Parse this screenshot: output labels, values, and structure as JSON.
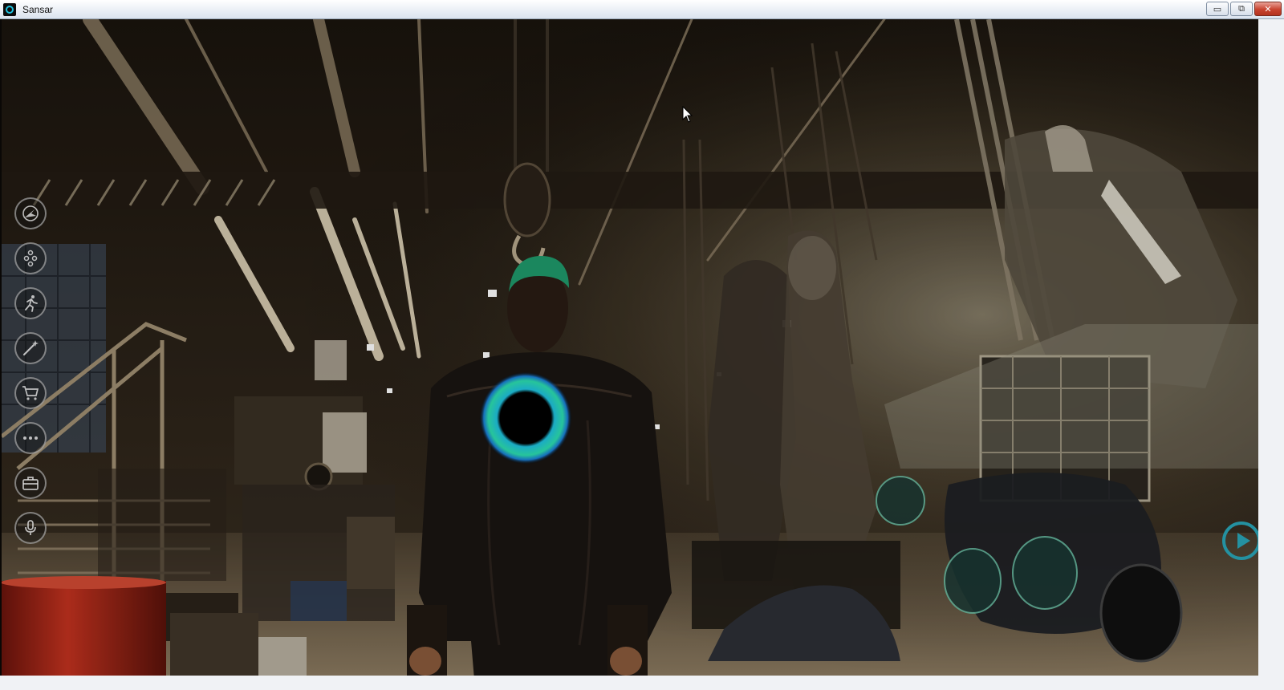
{
  "window": {
    "title": "Sansar",
    "controls": {
      "minimize": "▭",
      "restore": "⧉",
      "close": "✕"
    }
  },
  "toolbar": {
    "items": [
      {
        "id": "explore",
        "icon": "compass-plane-icon"
      },
      {
        "id": "people",
        "icon": "people-icon"
      },
      {
        "id": "emote",
        "icon": "running-figure-icon"
      },
      {
        "id": "edit",
        "icon": "magic-wand-icon"
      },
      {
        "id": "store",
        "icon": "shopping-cart-icon"
      },
      {
        "id": "more",
        "icon": "ellipsis-icon"
      },
      {
        "id": "inventory",
        "icon": "briefcase-icon"
      },
      {
        "id": "voice",
        "icon": "microphone-icon"
      }
    ]
  },
  "colors": {
    "logo_ring": "#1fc3e0",
    "avatar_hair": "#1f9a6b",
    "barrel_red": "#b3291d"
  }
}
